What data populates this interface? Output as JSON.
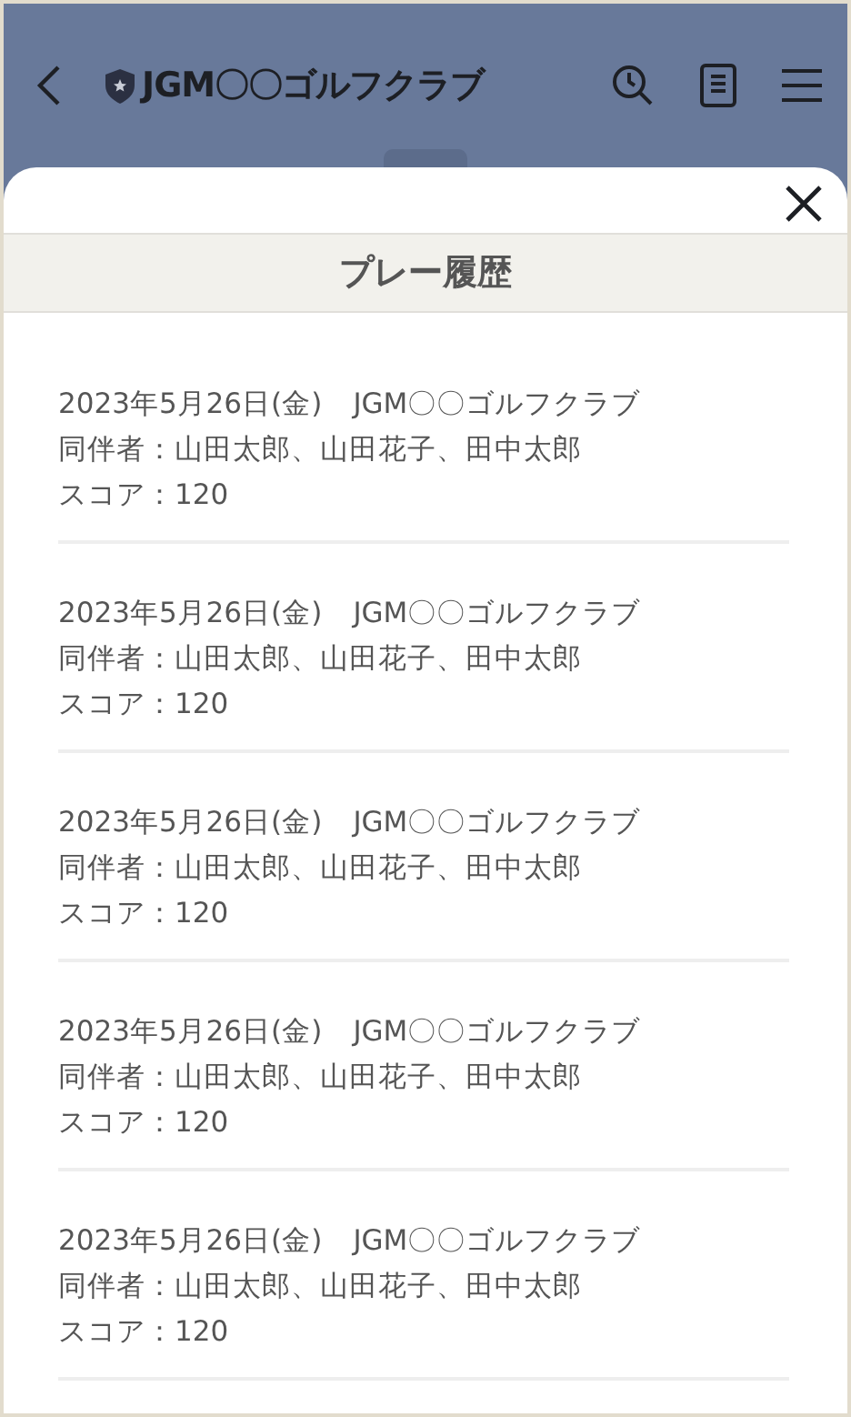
{
  "header": {
    "title": "JGM〇〇ゴルフクラブ"
  },
  "sheet": {
    "heading": "プレー履歴"
  },
  "history": [
    {
      "date": "2023年5月26日(金)",
      "course": "JGM〇〇ゴルフクラブ",
      "companions": "同伴者：山田太郎、山田花子、田中太郎",
      "score": "スコア：120"
    },
    {
      "date": "2023年5月26日(金)",
      "course": "JGM〇〇ゴルフクラブ",
      "companions": "同伴者：山田太郎、山田花子、田中太郎",
      "score": "スコア：120"
    },
    {
      "date": "2023年5月26日(金)",
      "course": "JGM〇〇ゴルフクラブ",
      "companions": "同伴者：山田太郎、山田花子、田中太郎",
      "score": "スコア：120"
    },
    {
      "date": "2023年5月26日(金)",
      "course": "JGM〇〇ゴルフクラブ",
      "companions": "同伴者：山田太郎、山田花子、田中太郎",
      "score": "スコア：120"
    },
    {
      "date": "2023年5月26日(金)",
      "course": "JGM〇〇ゴルフクラブ",
      "companions": "同伴者：山田太郎、山田花子、田中太郎",
      "score": "スコア：120"
    }
  ]
}
